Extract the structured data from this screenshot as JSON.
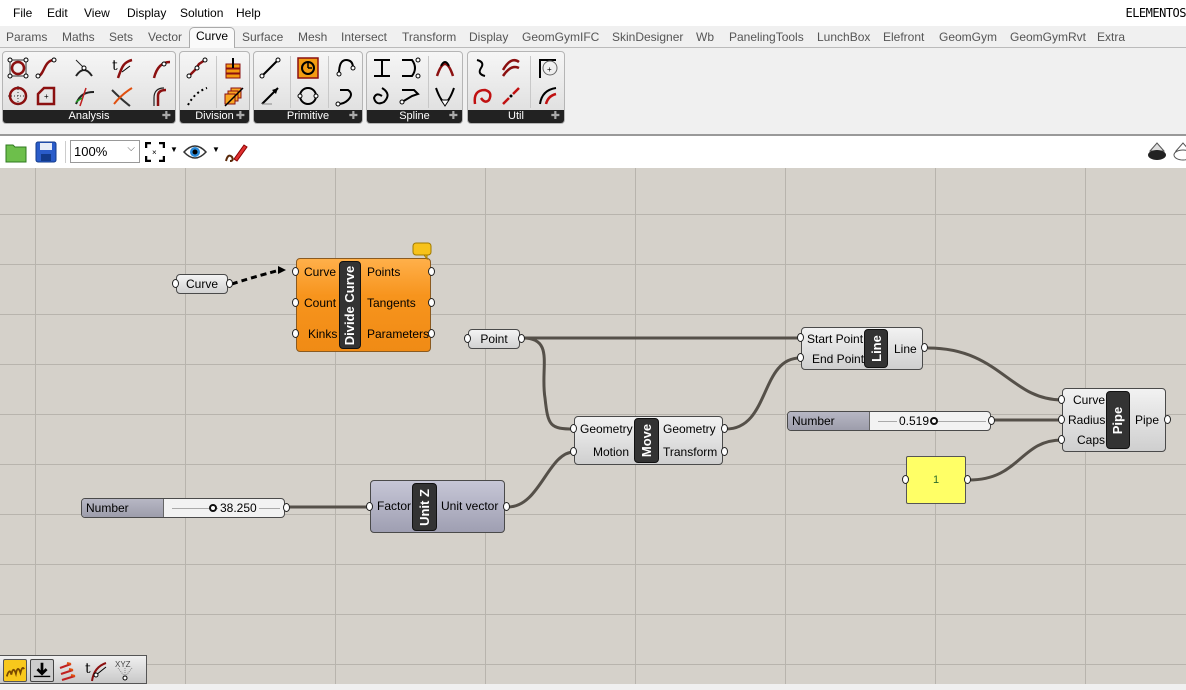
{
  "menu": {
    "items": [
      "File",
      "Edit",
      "View",
      "Display",
      "Solution",
      "Help"
    ],
    "app_name": "ELEMENTOS"
  },
  "tabs": {
    "items": [
      "Params",
      "Maths",
      "Sets",
      "Vector",
      "Curve",
      "Surface",
      "Mesh",
      "Intersect",
      "Transform",
      "Display",
      "GeomGymIFC",
      "SkinDesigner",
      "Wb",
      "PanelingTools",
      "LunchBox",
      "Elefront",
      "GeomGym",
      "GeomGymRvt",
      "Extra"
    ],
    "active": "Curve"
  },
  "ribbon": {
    "panels": [
      {
        "label": "Analysis",
        "icons": [
          "control-points-icon",
          "curve-closest-icon",
          "curve-end-points-icon",
          "evaluate-curve-icon",
          "curve-discontinuity-icon",
          "point-in-curve-icon",
          "polygon-center-icon",
          "curve-frame-icon",
          "curve-curvature-icon",
          "curve-side-icon"
        ]
      },
      {
        "label": "Division",
        "icons": [
          "divide-curve-icon",
          "contour-icon",
          "divide-distance-icon",
          "curve-frames-icon"
        ]
      },
      {
        "label": "Primitive",
        "icons": [
          "line-icon",
          "rectangle-icon",
          "arc-icon",
          "line-sdl-icon",
          "circle-icon",
          "arc-3pt-icon"
        ]
      },
      {
        "label": "Spline",
        "icons": [
          "tween-curve-icon",
          "nurbs-curve-icon",
          "bezier-span-icon",
          "interpolate-icon",
          "polyline-icon",
          "kinky-curve-icon"
        ]
      },
      {
        "label": "Util",
        "icons": [
          "explode-icon",
          "offset-curve-icon",
          "fillet-icon",
          "spiral-icon",
          "join-curves-icon",
          "extend-curve-icon"
        ]
      }
    ]
  },
  "toolbar": {
    "zoom_value": "100%",
    "icons": [
      "open-file-icon",
      "save-file-icon",
      "zoom-extents-icon",
      "preview-eye-icon",
      "sketch-pencil-icon"
    ],
    "right_icons": [
      "preview-shaded-icon",
      "preview-wire-icon"
    ]
  },
  "canvas": {
    "components": {
      "curve_param": {
        "label": "Curve"
      },
      "divide_curve": {
        "nickname": "Divide Curve",
        "inputs": [
          "Curve",
          "Count",
          "Kinks"
        ],
        "outputs": [
          "Points",
          "Tangents",
          "Parameters"
        ]
      },
      "point_param": {
        "label": "Point"
      },
      "line": {
        "nickname": "Line",
        "inputs": [
          "Start Point",
          "End Point"
        ],
        "outputs": [
          "Line"
        ]
      },
      "move": {
        "nickname": "Move",
        "inputs": [
          "Geometry",
          "Motion"
        ],
        "outputs": [
          "Geometry",
          "Transform"
        ]
      },
      "unit_z": {
        "nickname": "Unit Z",
        "inputs": [
          "Factor"
        ],
        "outputs": [
          "Unit vector"
        ]
      },
      "pipe": {
        "nickname": "Pipe",
        "inputs": [
          "Curve",
          "Radius",
          "Caps"
        ],
        "outputs": [
          "Pipe"
        ]
      },
      "slider_radius": {
        "label": "Number Slider",
        "value": "0.519",
        "fraction": 0.52
      },
      "slider_factor": {
        "label": "Number Slider",
        "value": "38.250",
        "fraction": 0.38
      },
      "panel": {
        "value": "1"
      }
    }
  },
  "bottom_tools": [
    "sketch-tool-icon",
    "bake-icon",
    "vector-display-icon",
    "tangent-display-icon",
    "xyz-point-icon"
  ]
}
